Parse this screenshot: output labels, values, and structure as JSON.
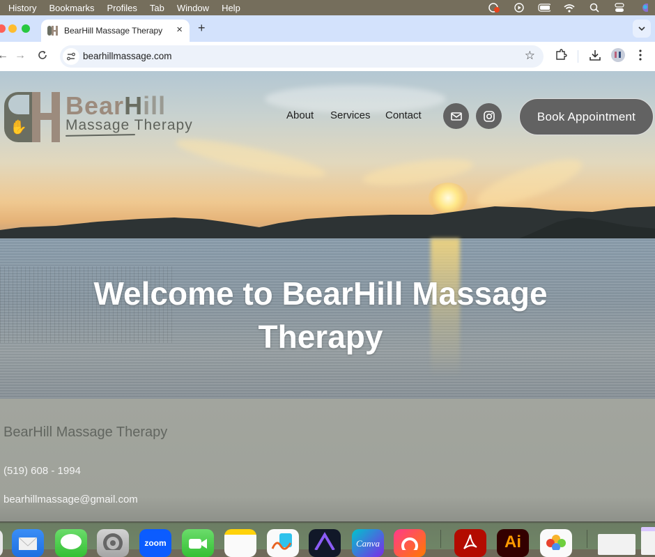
{
  "menubar": {
    "items": [
      "History",
      "Bookmarks",
      "Profiles",
      "Tab",
      "Window",
      "Help"
    ],
    "status_icons": [
      "screen-record-icon",
      "play-icon",
      "battery-icon",
      "wifi-icon",
      "spotlight-search-icon",
      "control-center-icon",
      "siri-icon"
    ]
  },
  "browser": {
    "tab": {
      "title": "BearHill Massage Therapy",
      "close_label": "×"
    },
    "new_tab_label": "+",
    "address": "bearhillmassage.com",
    "back_label": "←",
    "forward_label": "→",
    "reload_label": "C"
  },
  "site": {
    "logo": {
      "monogram": "BH",
      "title_bear": "Bear",
      "title_hill_h": "H",
      "title_hill_rest": "ill",
      "subtitle": "Massage Therapy"
    },
    "nav": [
      {
        "label": "About"
      },
      {
        "label": "Services"
      },
      {
        "label": "Contact"
      }
    ],
    "book_button": "Book Appointment",
    "hero_heading": "Welcome to BearHill Massage Therapy",
    "footer": {
      "business_name": "BearHill Massage Therapy",
      "phone": "(519) 608 - 1994",
      "email": "bearhillmassage@gmail.com"
    }
  },
  "dock": {
    "apps": [
      "Mail",
      "Messages",
      "System Settings",
      "Zoom",
      "FaceTime",
      "Notes",
      "Freeform",
      "Affinity",
      "Canva",
      "Creative Cloud",
      "Acrobat",
      "Illustrator",
      "Photos",
      "Window preview",
      "Window preview"
    ]
  },
  "colors": {
    "menubar": "#756e5c",
    "tabstrip": "#d3e2fc",
    "button_gray": "#626262",
    "footer_bg": "#a2a59e",
    "logo_brown": "#9c8b7d",
    "logo_green": "#6a6e62"
  }
}
